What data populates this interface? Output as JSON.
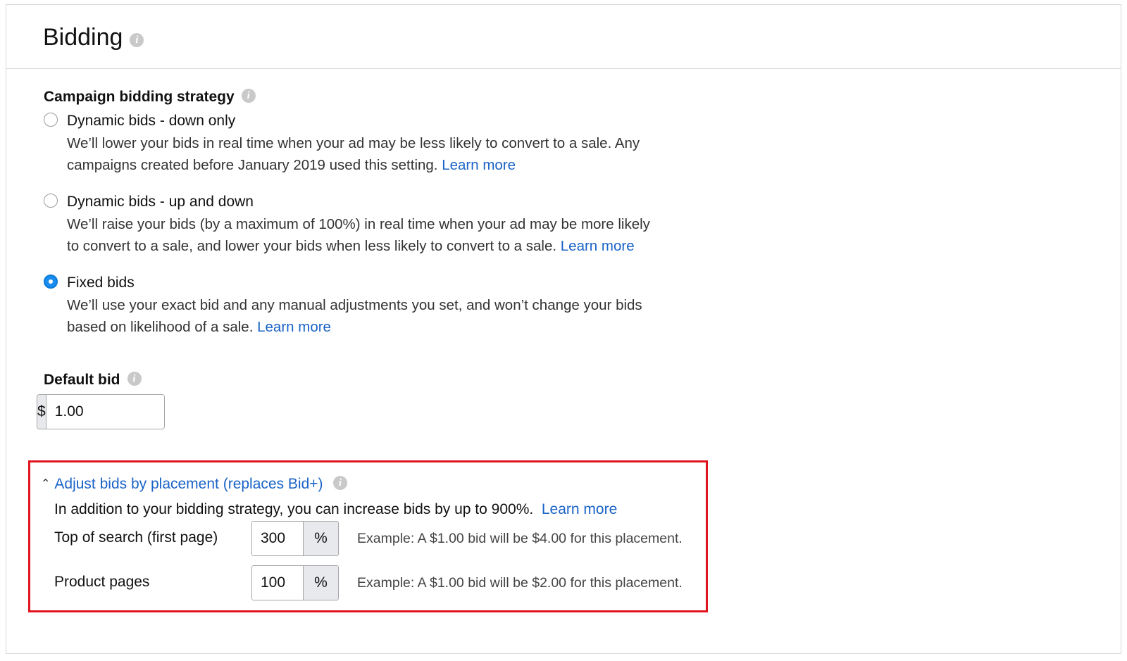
{
  "header": {
    "title": "Bidding"
  },
  "strategy": {
    "label": "Campaign bidding strategy",
    "options": [
      {
        "title": "Dynamic bids - down only",
        "desc_line1": "We’ll lower your bids in real time when your ad may be less likely to convert to a sale. Any",
        "desc_line2": "campaigns created before January 2019 used this setting.",
        "link": "Learn more",
        "selected": false
      },
      {
        "title": "Dynamic bids - up and down",
        "desc_line1": "We’ll raise your bids (by a maximum of 100%) in real time when your ad may be more likely",
        "desc_line2": "to convert to a sale, and lower your bids when less likely to convert to a sale.",
        "link": "Learn more",
        "selected": false
      },
      {
        "title": "Fixed bids",
        "desc_line1": "We’ll use your exact bid and any manual adjustments you set, and won’t change your bids",
        "desc_line2": "based on likelihood of a sale.",
        "link": "Learn more",
        "selected": true
      }
    ]
  },
  "default_bid": {
    "label": "Default bid",
    "currency": "$",
    "value": "1.00"
  },
  "placement": {
    "toggle_label": "Adjust bids by placement (replaces Bid+)",
    "intro": "In addition to your bidding strategy, you can increase bids by up to 900%.",
    "intro_link": "Learn more",
    "rows": [
      {
        "label": "Top of search (first page)",
        "value": "300",
        "unit": "%",
        "example": "Example: A $1.00 bid will be $4.00 for this placement."
      },
      {
        "label": "Product pages",
        "value": "100",
        "unit": "%",
        "example": "Example: A $1.00 bid will be $2.00 for this placement."
      }
    ]
  },
  "colors": {
    "accent_link": "#1a63c7",
    "highlight_border": "#e0141c",
    "radio_selected": "#1a8cf0"
  },
  "icons": {
    "info": "info-icon",
    "chevron": "chevron-up-icon"
  }
}
